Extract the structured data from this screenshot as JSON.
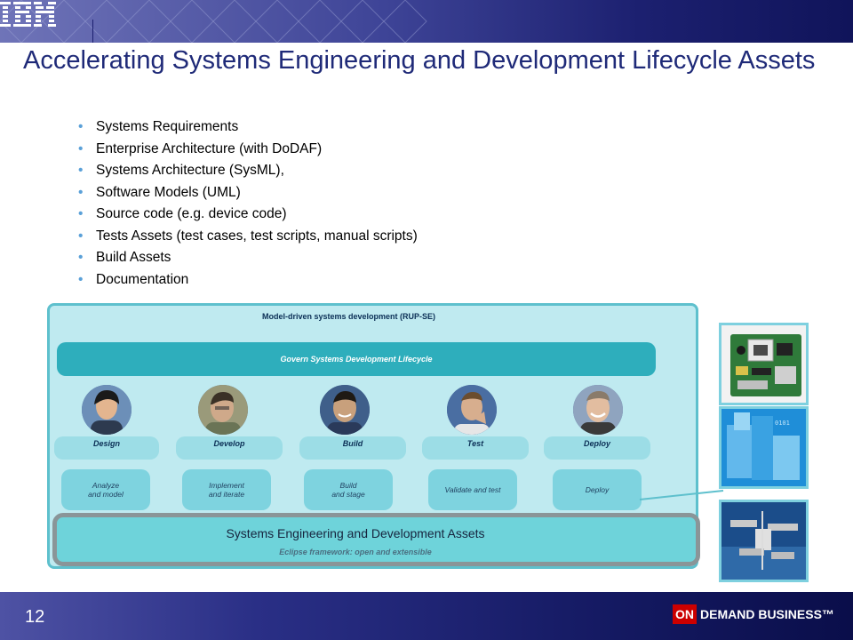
{
  "slide": {
    "title": "Accelerating Systems Engineering and Development Lifecycle Assets",
    "page_number": "12",
    "brand_logo": "IBM"
  },
  "bullets": [
    "Systems Requirements",
    "Enterprise Architecture (with DoDAF)",
    "Systems Architecture (SysML),",
    "Software Models (UML)",
    "Source code (e.g. device code)",
    "Tests Assets (test cases, test scripts, manual scripts)",
    "Build Assets",
    "Documentation"
  ],
  "diagram": {
    "title": "Model-driven systems development (RUP-SE)",
    "govern_label": "Govern Systems Development Lifecycle",
    "roles": [
      "Design",
      "Develop",
      "Build",
      "Test",
      "Deploy"
    ],
    "activities": [
      {
        "line1": "Analyze",
        "line2": "and model"
      },
      {
        "line1": "Implement",
        "line2": "and iterate"
      },
      {
        "line1": "Build",
        "line2": "and stage"
      },
      {
        "line1": "Validate and test",
        "line2": ""
      },
      {
        "line1": "Deploy",
        "line2": ""
      }
    ],
    "assets_title": "Systems Engineering and Development Assets",
    "assets_subtitle": "Eclipse framework: open and extensible"
  },
  "images": [
    "circuit-board-image",
    "blue-blocks-image",
    "space-station-image"
  ],
  "footer": {
    "badge_on": "ON",
    "badge_text": "DEMAND BUSINESS™"
  },
  "colors": {
    "title": "#1f2a78",
    "bullet_dot": "#5aa0d8",
    "panel_bg": "#bfeaf0",
    "govern_bar": "#2eaebc",
    "badge_red": "#cc0000"
  }
}
